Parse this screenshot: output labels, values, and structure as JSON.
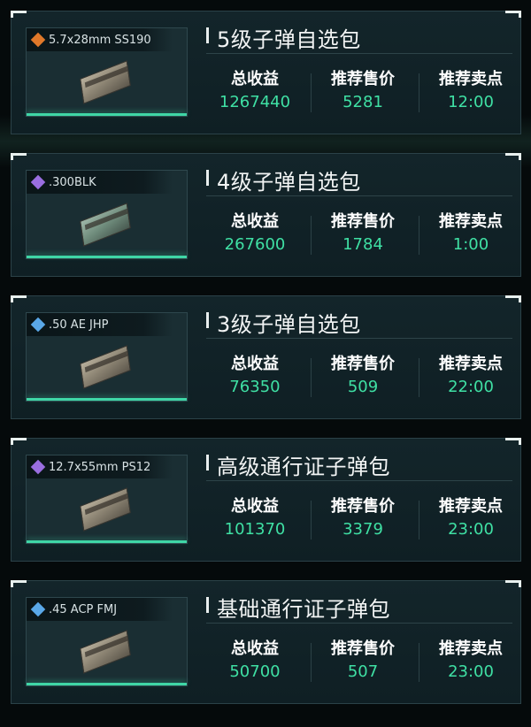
{
  "stat_labels": {
    "revenue": "总收益",
    "price": "推荐售价",
    "time": "推荐卖点"
  },
  "colors": {
    "accent_green": "#3fe0a4",
    "rarity_gold": "#e0782a",
    "rarity_purple": "#9a6ee0",
    "rarity_blue": "#5aa8e8"
  },
  "cards": [
    {
      "item_name": "5.7x28mm SS190",
      "rarity": "gold",
      "rarity_icon": "gold-diamond-icon",
      "title": "5级子弹自选包",
      "revenue": "1267440",
      "price": "5281",
      "time": "12:00"
    },
    {
      "item_name": ".300BLK",
      "rarity": "purple",
      "rarity_icon": "purple-diamond-icon",
      "title": "4级子弹自选包",
      "revenue": "267600",
      "price": "1784",
      "time": "1:00"
    },
    {
      "item_name": ".50 AE JHP",
      "rarity": "blue",
      "rarity_icon": "blue-diamond-icon",
      "title": "3级子弹自选包",
      "revenue": "76350",
      "price": "509",
      "time": "22:00"
    },
    {
      "item_name": "12.7x55mm PS12",
      "rarity": "purple",
      "rarity_icon": "purple-diamond-icon",
      "title": "高级通行证子弹包",
      "revenue": "101370",
      "price": "3379",
      "time": "23:00"
    },
    {
      "item_name": ".45 ACP FMJ",
      "rarity": "blue",
      "rarity_icon": "blue-diamond-icon",
      "title": "基础通行证子弹包",
      "revenue": "50700",
      "price": "507",
      "time": "23:00"
    }
  ]
}
